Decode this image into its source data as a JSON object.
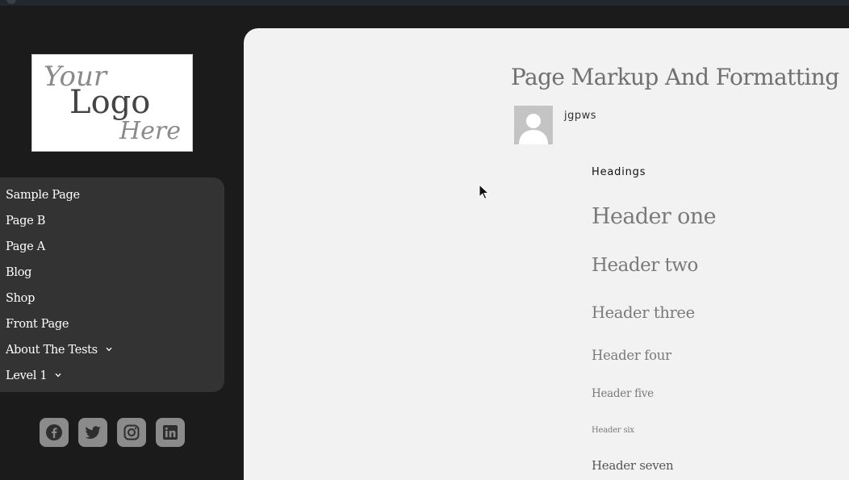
{
  "logo": {
    "line1": "Your",
    "line2": "Logo",
    "line3": "Here"
  },
  "nav": {
    "items": [
      {
        "label": "Sample Page",
        "has_submenu": false
      },
      {
        "label": "Page B",
        "has_submenu": false
      },
      {
        "label": "Page A",
        "has_submenu": false
      },
      {
        "label": "Blog",
        "has_submenu": false
      },
      {
        "label": "Shop",
        "has_submenu": false
      },
      {
        "label": "Front Page",
        "has_submenu": false
      },
      {
        "label": "About The Tests",
        "has_submenu": true
      },
      {
        "label": "Level 1",
        "has_submenu": true
      }
    ]
  },
  "social": {
    "icons": [
      "facebook-icon",
      "twitter-icon",
      "instagram-icon",
      "linkedin-icon"
    ]
  },
  "post": {
    "title": "Page Markup And Formatting",
    "author": "jgpws",
    "section_label": "Headings",
    "headings": [
      "Header one",
      "Header two",
      "Header three",
      "Header four",
      "Header five",
      "Header six",
      "Header seven"
    ]
  },
  "colors": {
    "sidebar_bg": "#1b1b1b",
    "nav_bg": "#333333",
    "content_bg": "#f2f2f2",
    "social_button": "#8b8b8b",
    "heading_text": "#7a7a7a"
  }
}
